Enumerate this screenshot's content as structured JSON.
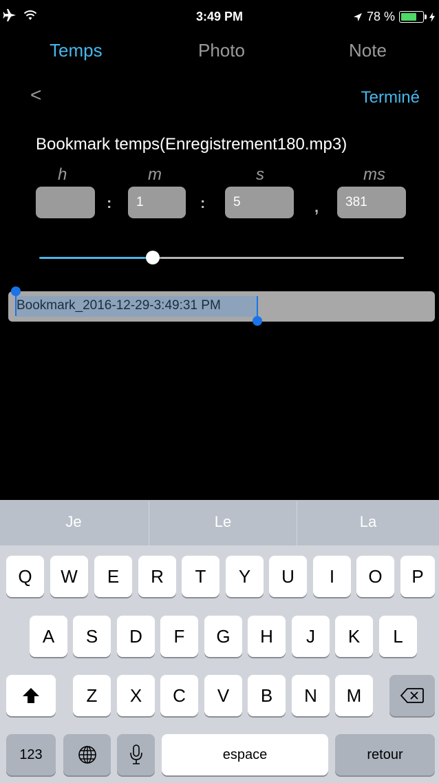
{
  "status_bar": {
    "time": "3:49 PM",
    "battery_pct": "78 %",
    "battery_level": 0.78,
    "icons": [
      "airplane-icon",
      "wifi-icon",
      "location-icon",
      "battery-icon",
      "charging-icon"
    ]
  },
  "tabs": [
    "Temps",
    "Photo",
    "Note"
  ],
  "active_tab": "Temps",
  "nav": {
    "back_symbol": "<",
    "done_label": "Terminé"
  },
  "bookmark_title": "Bookmark temps(Enregistrement180.mp3)",
  "time_units": {
    "h": "h",
    "m": "m",
    "s": "s",
    "ms": "ms"
  },
  "time_values": {
    "h": "",
    "m": "1",
    "s": "5",
    "ms": "381"
  },
  "separators": {
    "hm": ":",
    "ms": ":",
    "sms": ","
  },
  "slider": {
    "position": 0.31
  },
  "name_field": {
    "value": "Bookmark_2016-12-29-3:49:31 PM",
    "selected": true
  },
  "keyboard": {
    "suggestions": [
      "Je",
      "Le",
      "La"
    ],
    "row1": [
      "Q",
      "W",
      "E",
      "R",
      "T",
      "Y",
      "U",
      "I",
      "O",
      "P"
    ],
    "row2": [
      "A",
      "S",
      "D",
      "F",
      "G",
      "H",
      "J",
      "K",
      "L"
    ],
    "row3": [
      "Z",
      "X",
      "C",
      "V",
      "B",
      "N",
      "M"
    ],
    "numbers_label": "123",
    "space_label": "espace",
    "return_label": "retour"
  },
  "colors": {
    "accent": "#48b7ec",
    "selection": "#1a73e8",
    "battery": "#4cd964"
  }
}
